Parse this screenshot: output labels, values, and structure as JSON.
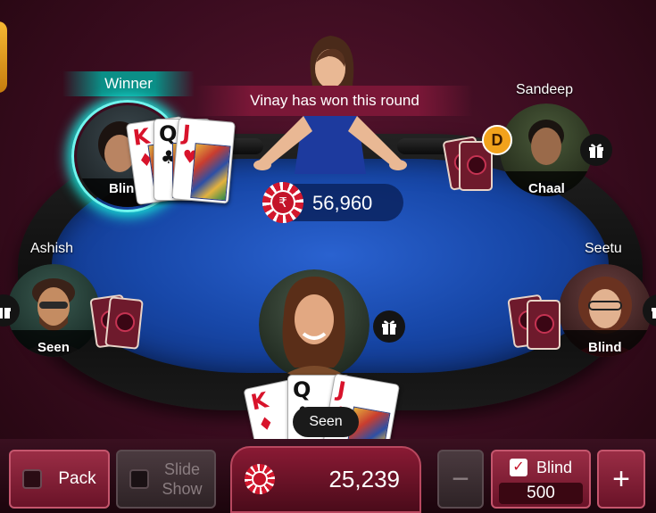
{
  "banner": {
    "winner_label": "Winner",
    "round_message": "Vinay has won this round"
  },
  "pot": {
    "amount": "56,960",
    "currency_symbol": "₹"
  },
  "dealer_badge": "D",
  "players": {
    "top_left": {
      "status": "Blin"
    },
    "top_right": {
      "name": "Sandeep",
      "status": "Chaal"
    },
    "left": {
      "name": "Ashish",
      "status": "Seen"
    },
    "right": {
      "name": "Seetu",
      "status": "Blind"
    },
    "self": {
      "status": "Seen"
    }
  },
  "winner_cards": [
    {
      "rank": "K",
      "suit": "♦",
      "color": "red"
    },
    {
      "rank": "Q",
      "suit": "♣",
      "color": "black"
    },
    {
      "rank": "J",
      "suit": "♥",
      "color": "red"
    }
  ],
  "self_cards": [
    {
      "rank": "K",
      "suit": "♦",
      "color": "red"
    },
    {
      "rank": "Q",
      "suit": "♣",
      "color": "black"
    },
    {
      "rank": "J",
      "suit": "♥",
      "color": "red"
    }
  ],
  "controls": {
    "pack_label": "Pack",
    "slide_show_line1": "Slide",
    "slide_show_line2": "Show",
    "balance": "25,239",
    "minus_label": "−",
    "blind_label": "Blind",
    "blind_check": "✓",
    "blind_amount": "500",
    "plus_label": "+"
  },
  "colors": {
    "felt": "#1747a8",
    "accent_red": "#9a2d45",
    "winner_glow": "#19e0d6",
    "dealer_badge": "#f2a21c"
  }
}
